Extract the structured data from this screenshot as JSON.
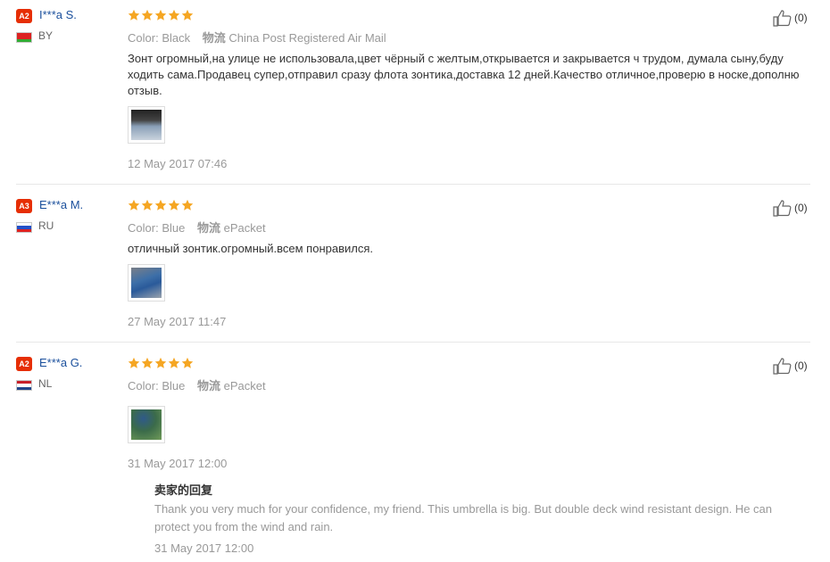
{
  "reviews": [
    {
      "level": "A2",
      "name": "I***a S.",
      "country": "BY",
      "flag_colors": [
        "#d22",
        "#d22",
        "#3a3"
      ],
      "stars": 5,
      "color_label": "Color:",
      "color_value": "Black",
      "shipping_label": "物流",
      "shipping_value": "China Post Registered Air Mail",
      "text": "Зонт огромный,на улице не использовала,цвет чёрный с желтым,открывается и закрывается ч трудом, думала сыну,буду ходить сама.Продавец супер,отправил сразу флота зонтика,доставка 12 дней.Качество отличное,проверю в носке,дополню отзыв.",
      "date": "12 May 2017 07:46",
      "likes": "(0)"
    },
    {
      "level": "A3",
      "name": "E***a M.",
      "country": "RU",
      "flag_colors": [
        "#fff",
        "#2250c8",
        "#d22"
      ],
      "stars": 5,
      "color_label": "Color:",
      "color_value": "Blue",
      "shipping_label": "物流",
      "shipping_value": "ePacket",
      "text": "отличный зонтик.огромный.всем понравился.",
      "date": "27 May 2017 11:47",
      "likes": "(0)"
    },
    {
      "level": "A2",
      "name": "E***a G.",
      "country": "NL",
      "flag_colors": [
        "#c8202a",
        "#fff",
        "#21468b"
      ],
      "stars": 5,
      "color_label": "Color:",
      "color_value": "Blue",
      "shipping_label": "物流",
      "shipping_value": "ePacket",
      "text": "",
      "date": "31 May 2017 12:00",
      "likes": "(0)",
      "reply": {
        "title": "卖家的回复",
        "text": "Thank you very much for your confidence, my friend. This umbrella is big. But double deck wind resistant design. He can protect you from the wind and rain.",
        "date": "31 May 2017 12:00"
      }
    }
  ],
  "colors": {
    "star": "#f5a623",
    "badge": "#e62e04",
    "username": "#1a4f9c"
  },
  "icons": {
    "star": "star-icon",
    "like": "thumbs-up-icon"
  }
}
